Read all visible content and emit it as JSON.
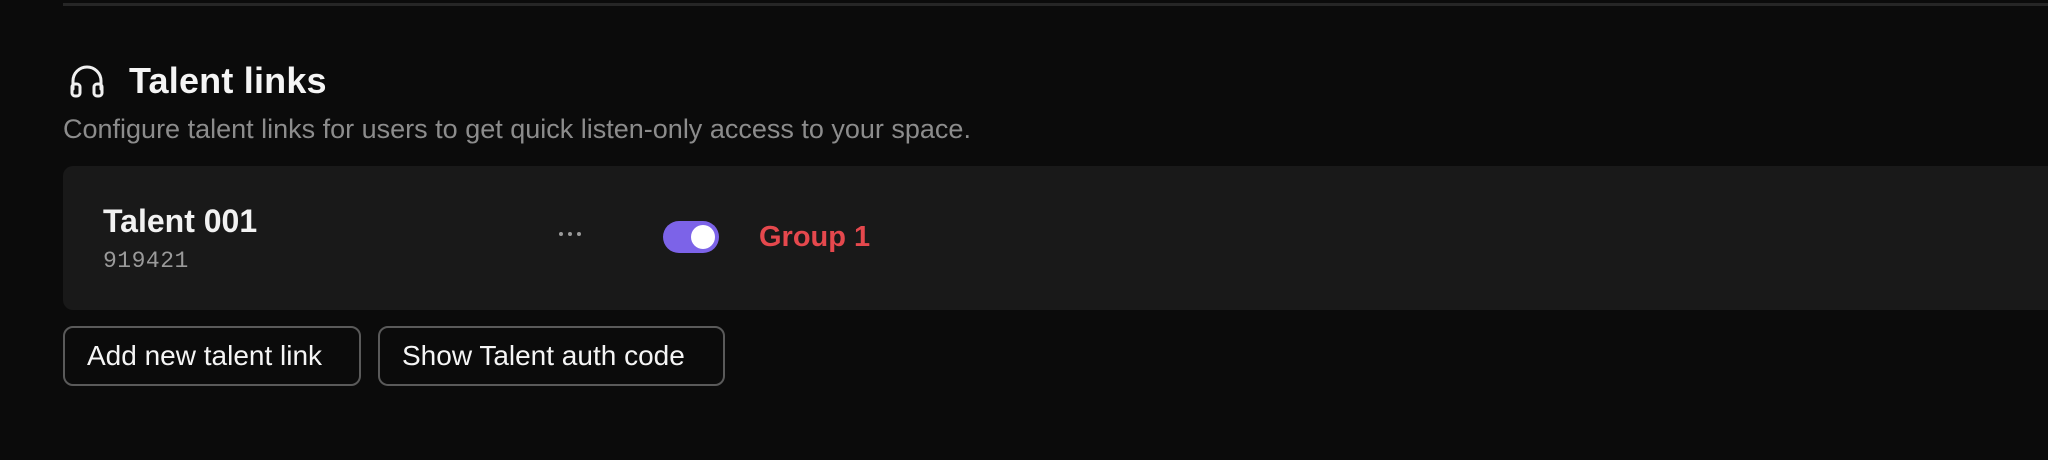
{
  "section": {
    "icon": "headphones-icon",
    "title": "Talent links",
    "description": "Configure talent links for users to get quick listen-only access to your space."
  },
  "talent_links": [
    {
      "name": "Talent 001",
      "code": "919421",
      "more_icon": "more-horizontal-icon",
      "enabled": true,
      "group": "Group 1"
    }
  ],
  "actions": {
    "add_label": "Add new talent link",
    "show_auth_label": "Show Talent auth code"
  },
  "colors": {
    "background": "#0b0b0b",
    "card": "#191919",
    "toggle_on": "#7c63e8",
    "group_text": "#e5484d",
    "muted_text": "#8c8c8c"
  }
}
